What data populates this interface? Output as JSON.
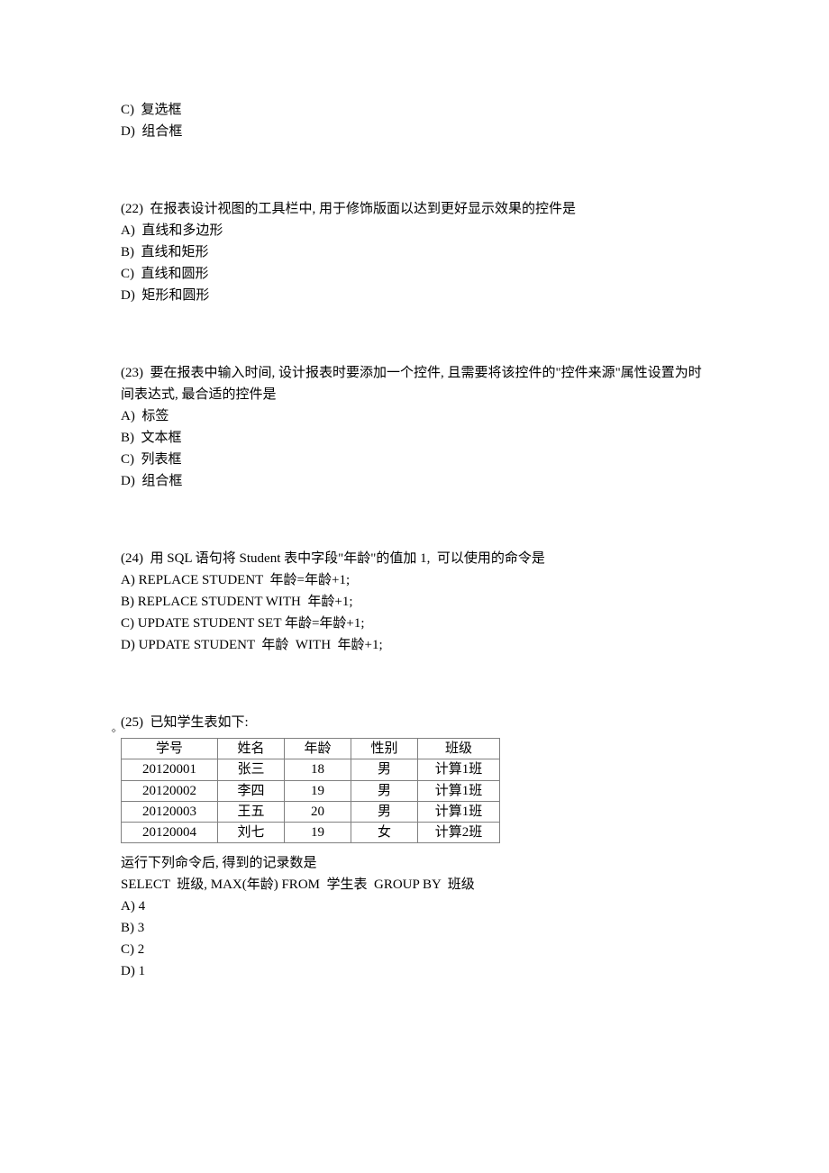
{
  "intro": {
    "optC": "C)  复选框",
    "optD": "D)  组合框"
  },
  "q22": {
    "prompt": "(22)  在报表设计视图的工具栏中, 用于修饰版面以达到更好显示效果的控件是",
    "optA": "A)  直线和多边形",
    "optB": "B)  直线和矩形",
    "optC": "C)  直线和圆形",
    "optD": "D)  矩形和圆形"
  },
  "q23": {
    "prompt": "(23)  要在报表中输入时间, 设计报表时要添加一个控件, 且需要将该控件的\"控件来源\"属性设置为时间表达式, 最合适的控件是",
    "optA": "A)  标签",
    "optB": "B)  文本框",
    "optC": "C)  列表框",
    "optD": "D)  组合框"
  },
  "q24": {
    "prompt": "(24)  用 SQL 语句将 Student 表中字段\"年龄\"的值加 1,  可以使用的命令是",
    "optA": "A) REPLACE STUDENT  年龄=年龄+1;",
    "optB": "B) REPLACE STUDENT WITH  年龄+1;",
    "optC": "C) UPDATE STUDENT SET 年龄=年龄+1;",
    "optD": "D) UPDATE STUDENT  年龄  WITH  年龄+1;"
  },
  "q25": {
    "prompt": "(25)  已知学生表如下:",
    "table": {
      "headers": [
        "学号",
        "姓名",
        "年龄",
        "性别",
        "班级"
      ],
      "rows": [
        [
          "20120001",
          "张三",
          "18",
          "男",
          "计算1班"
        ],
        [
          "20120002",
          "李四",
          "19",
          "男",
          "计算1班"
        ],
        [
          "20120003",
          "王五",
          "20",
          "男",
          "计算1班"
        ],
        [
          "20120004",
          "刘七",
          "19",
          "女",
          "计算2班"
        ]
      ]
    },
    "after1": "运行下列命令后, 得到的记录数是",
    "after2": "SELECT  班级, MAX(年龄) FROM  学生表  GROUP BY  班级",
    "optA": "A) 4",
    "optB": "B) 3",
    "optC": "C) 2",
    "optD": "D) 1"
  }
}
